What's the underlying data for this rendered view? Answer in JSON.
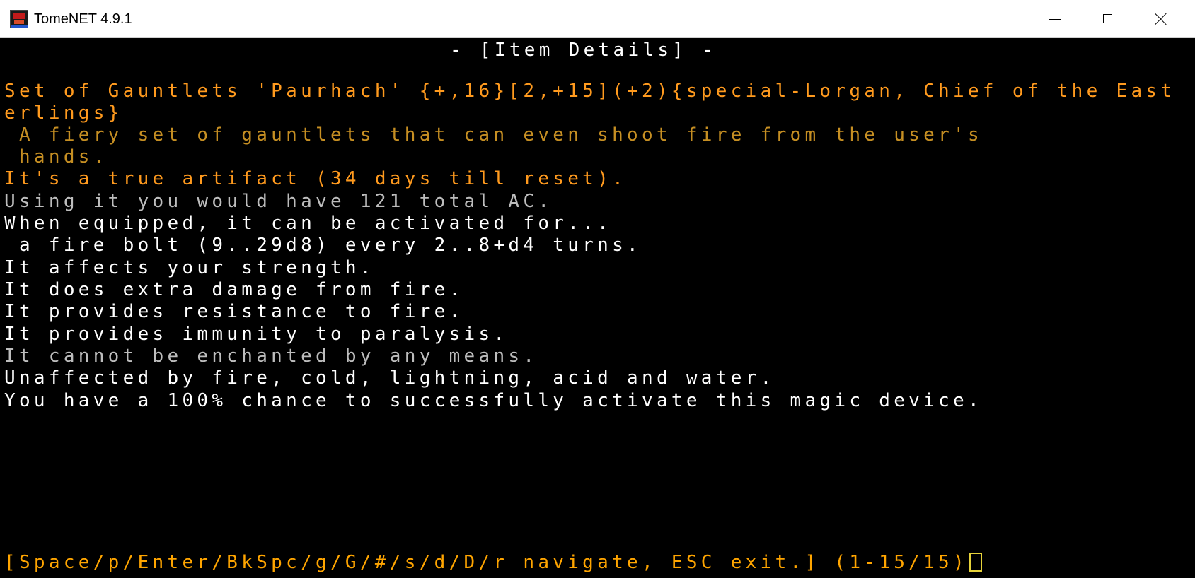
{
  "window": {
    "title": "TomeNET 4.9.1",
    "app_icon": "tomenet-app-icon",
    "controls": {
      "minimize_icon": "minimize-icon",
      "maximize_icon": "maximize-icon",
      "close_icon": "close-icon"
    }
  },
  "screen": {
    "header": "- [Item Details] -",
    "item_name_line1": "Set of Gauntlets 'Paurhach' {+,16}[2,+15](+2){special-Lorgan, Chief of the East",
    "item_name_line2": "erlings}",
    "description_line1": " A fiery set of gauntlets that can even shoot fire from the user's",
    "description_line2": " hands.",
    "artifact_line": "It's a true artifact (34 days till reset).",
    "ac_line": "Using it you would have 121 total AC.",
    "activation_line": "When equipped, it can be activated for...",
    "activation_detail": " a fire bolt (9..29d8) every 2..8+d4 turns.",
    "affects_line": "It affects your strength.",
    "damage_line": "It does extra damage from fire.",
    "resist_line": "It provides resistance to fire.",
    "immunity_line": "It provides immunity to paralysis.",
    "enchant_line": "It cannot be enchanted by any means.",
    "unaffected_line": "Unaffected by fire, cold, lightning, acid and water.",
    "chance_line": "You have a 100% chance to successfully activate this magic device.",
    "prompt": "[Space/p/Enter/BkSpc/g/G/#/s/d/D/r navigate, ESC exit.] (1-15/15)"
  },
  "colors": {
    "terminal_background": "#000000",
    "text_white": "#ffffff",
    "text_gray": "#bdbdbd",
    "text_orange": "#ff9a1e",
    "text_umber": "#c68f23",
    "prompt_yellow": "#ffa500",
    "cursor": "#e6d23a"
  }
}
